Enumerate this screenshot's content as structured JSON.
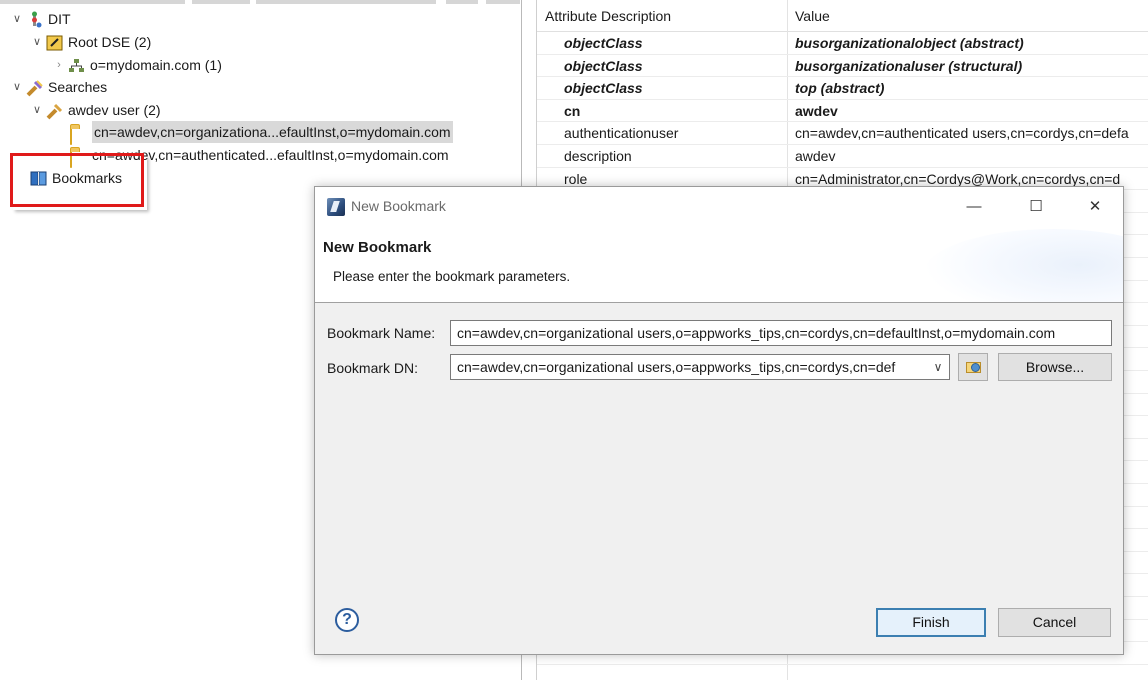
{
  "tree": {
    "dit": "DIT",
    "root_dse": "Root DSE (2)",
    "domain": "o=mydomain.com (1)",
    "searches": "Searches",
    "search_item": "awdev user (2)",
    "result_1": "cn=awdev,cn=organizationa...efaultInst,o=mydomain.com",
    "result_2": "cn=awdev,cn=authenticated...efaultInst,o=mydomain.com",
    "bookmarks": "Bookmarks"
  },
  "attributes": {
    "header_key": "Attribute Description",
    "header_value": "Value",
    "rows": [
      {
        "key": "objectClass",
        "value": "busorganizationalobject (abstract)",
        "style": "bi"
      },
      {
        "key": "objectClass",
        "value": "busorganizationaluser (structural)",
        "style": "bi"
      },
      {
        "key": "objectClass",
        "value": "top (abstract)",
        "style": "bi"
      },
      {
        "key": "cn",
        "value": "awdev",
        "style": "b"
      },
      {
        "key": "authenticationuser",
        "value": "cn=awdev,cn=authenticated users,cn=cordys,cn=defa",
        "style": ""
      },
      {
        "key": "description",
        "value": "awdev",
        "style": ""
      },
      {
        "key": "role",
        "value": "cn=Administrator,cn=Cordys@Work,cn=cordys,cn=d",
        "style": ""
      },
      {
        "key": "",
        "value": "efau",
        "style": ""
      },
      {
        "key": "",
        "value": "oles,",
        "style": ""
      }
    ]
  },
  "dialog": {
    "window_title": "New Bookmark",
    "header_title": "New Bookmark",
    "header_message": "Please enter the bookmark parameters.",
    "name_label": "Bookmark Name:",
    "name_value": "cn=awdev,cn=organizational users,o=appworks_tips,cn=cordys,cn=defaultInst,o=mydomain.com",
    "dn_label": "Bookmark DN:",
    "dn_value": "cn=awdev,cn=organizational users,o=appworks_tips,cn=cordys,cn=def",
    "browse_label": "Browse...",
    "help_glyph": "?",
    "finish_label": "Finish",
    "cancel_label": "Cancel",
    "minimize_glyph": "—",
    "maximize_glyph": "☐",
    "close_glyph": "✕"
  },
  "colors": {
    "highlight": "#e01a1a",
    "default_button_border": "#3c7fb1"
  }
}
